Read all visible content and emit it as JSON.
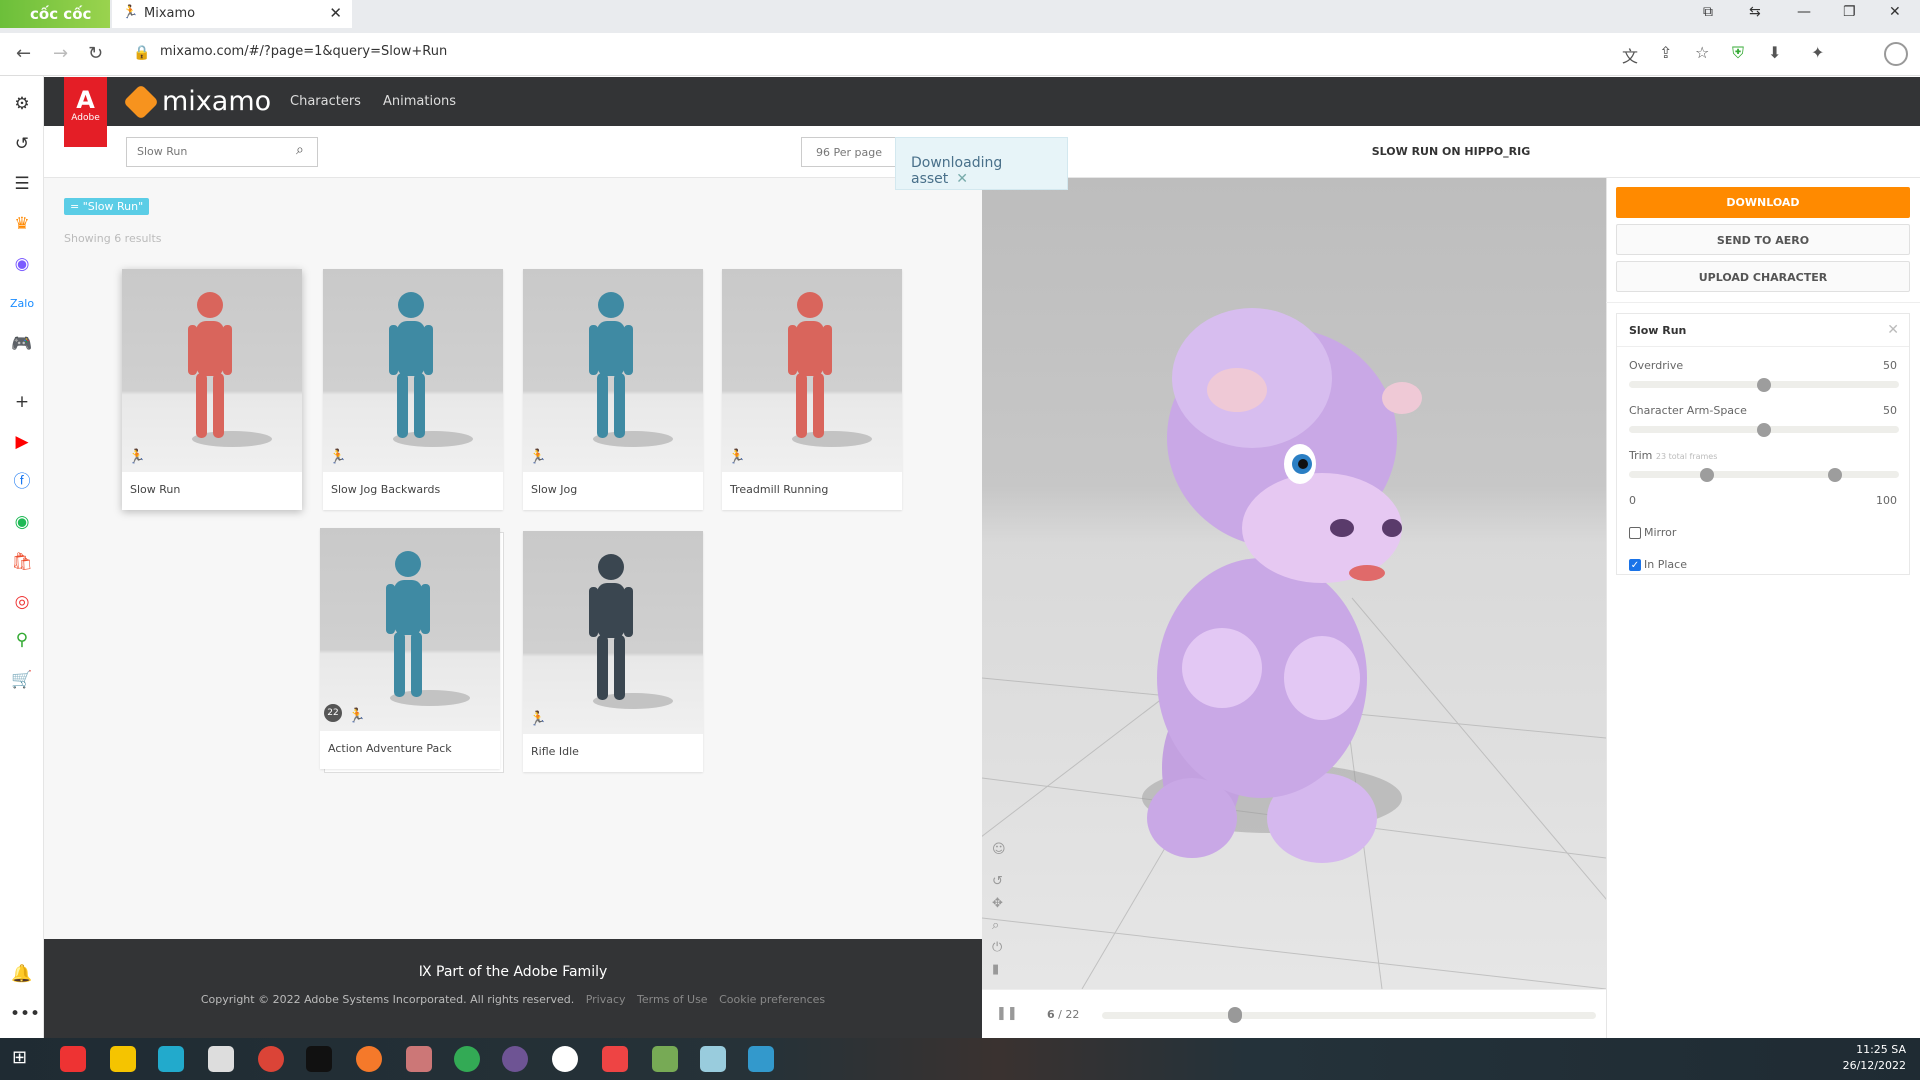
{
  "browser": {
    "brand": "cốc cốc",
    "tab_title": "Mixamo",
    "url": "mixamo.com/#/?page=1&query=Slow+Run"
  },
  "header": {
    "adobe_label": "Adobe",
    "logo": "mixamo",
    "nav": [
      "Characters",
      "Animations"
    ]
  },
  "toolbar": {
    "search_value": "Slow Run",
    "per_page": "96 Per page",
    "toast": "Downloading asset",
    "viewer_title": "SLOW RUN ON HIPPO_RIG"
  },
  "results": {
    "filter_chip": "= \"Slow Run\"",
    "count_text": "Showing 6 results",
    "cards": [
      {
        "label": "Slow Run",
        "color": "#d9655c",
        "selected": true
      },
      {
        "label": "Slow Jog Backwards",
        "color": "#3f8aa3"
      },
      {
        "label": "Slow Jog",
        "color": "#3f8aa3"
      },
      {
        "label": "Treadmill Running",
        "color": "#d9655c"
      },
      {
        "label": "Action Adventure Pack",
        "color": "#3f8aa3",
        "badge": "22"
      },
      {
        "label": "Rifle Idle",
        "color": "#3a4650"
      }
    ]
  },
  "footer": {
    "title": "Part of the Adobe Family",
    "copyright": "Copyright © 2022 Adobe Systems Incorporated. All rights reserved.",
    "links": [
      "Privacy",
      "Terms of Use",
      "Cookie preferences"
    ]
  },
  "player": {
    "frame": "6",
    "total": "/ 22",
    "progress": 0.27
  },
  "panel": {
    "download": "DOWNLOAD",
    "send_to_aero": "SEND TO AERO",
    "upload_character": "UPLOAD CHARACTER",
    "settings_title": "Slow Run",
    "overdrive_label": "Overdrive",
    "overdrive_value": "50",
    "armspace_label": "Character Arm-Space",
    "armspace_value": "50",
    "trim_label": "Trim",
    "trim_hint": "23 total frames",
    "trim_min": "0",
    "trim_max": "100",
    "trim_range": [
      27,
      75
    ],
    "mirror_label": "Mirror",
    "mirror_checked": false,
    "inplace_label": "In Place",
    "inplace_checked": true
  },
  "taskbar": {
    "time": "11:25 SA",
    "date": "26/12/2022"
  },
  "colors": {
    "accent": "#ff8a00",
    "header": "#333436",
    "adobe": "#e41e26",
    "hippo": "#c9a8e6"
  }
}
